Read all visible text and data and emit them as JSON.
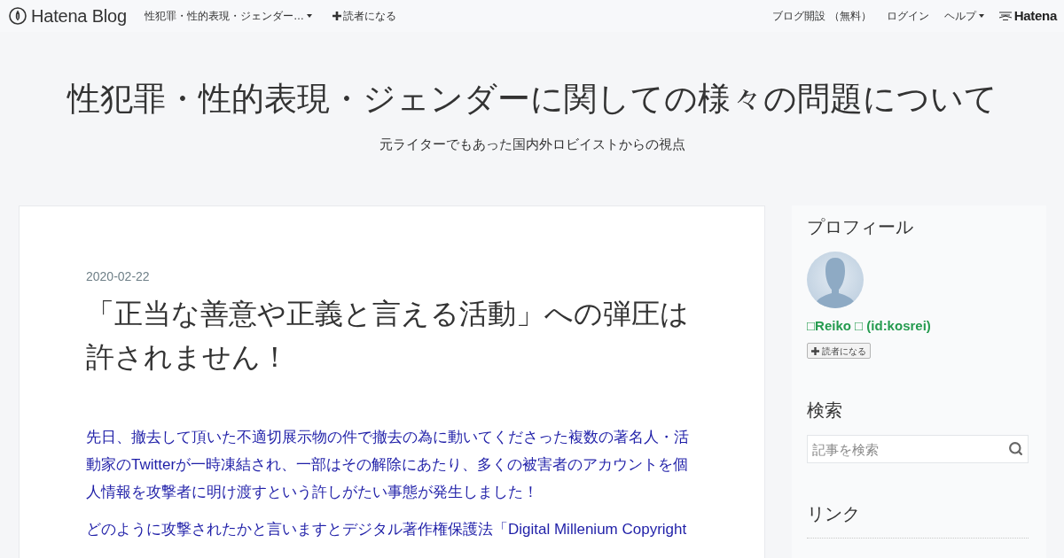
{
  "top_bar": {
    "logo": "Hatena Blog",
    "blog_menu": "性犯罪・性的表現・ジェンダー…",
    "subscribe": "読者になる",
    "links": [
      {
        "label": "ブログ開設 （無料）",
        "dropdown": false
      },
      {
        "label": "ログイン",
        "dropdown": false
      },
      {
        "label": "ヘルプ",
        "dropdown": true
      }
    ],
    "brand": "Hatena"
  },
  "header": {
    "title": "性犯罪・性的表現・ジェンダーに関しての様々の問題について",
    "subtitle": "元ライターでもあった国内外ロビイストからの視点"
  },
  "article": {
    "date": "2020-02-22",
    "title": "「正当な善意や正義と言える活動」への弾圧は許されません！",
    "paragraphs": [
      "先日、撤去して頂いた不適切展示物の件で撤去の為に動いてくださった複数の著名人・活動家のTwitterが一時凍結され、一部はその解除にあたり、多くの被害者のアカウントを個人情報を攻撃者に明け渡すという許しがたい事態が発生しました！",
      "どのように攻撃されたかと言いますとデジタル著作権保護法「Digital Millenium Copyright"
    ]
  },
  "sidebar": {
    "sections": [
      {
        "kind": "profile",
        "heading": "プロフィール",
        "name": "□Reiko □ (id:kosrei)",
        "button": "読者になる"
      },
      {
        "kind": "search",
        "heading": "検索",
        "placeholder": "記事を検索"
      },
      {
        "kind": "links",
        "heading": "リンク"
      }
    ]
  }
}
